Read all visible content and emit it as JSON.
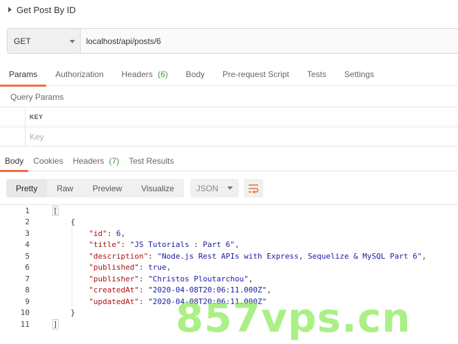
{
  "request": {
    "name": "Get Post By ID",
    "method": "GET",
    "url": "localhost/api/posts/6"
  },
  "request_tabs": [
    {
      "label": "Params",
      "count": ""
    },
    {
      "label": "Authorization",
      "count": ""
    },
    {
      "label": "Headers",
      "count": "(6)"
    },
    {
      "label": "Body",
      "count": ""
    },
    {
      "label": "Pre-request Script",
      "count": ""
    },
    {
      "label": "Tests",
      "count": ""
    },
    {
      "label": "Settings",
      "count": ""
    }
  ],
  "query_params": {
    "label": "Query Params",
    "column_header": "KEY",
    "key_placeholder": "Key"
  },
  "response_tabs": [
    {
      "label": "Body",
      "count": ""
    },
    {
      "label": "Cookies",
      "count": ""
    },
    {
      "label": "Headers",
      "count": "(7)"
    },
    {
      "label": "Test Results",
      "count": ""
    }
  ],
  "view_modes": [
    "Pretty",
    "Raw",
    "Preview",
    "Visualize"
  ],
  "format": "JSON",
  "icons": {
    "caret": "caret-right-icon",
    "dropdown": "chevron-down-icon",
    "wrap": "wrap-lines-icon"
  },
  "colors": {
    "accent": "#f26b3a",
    "count": "#3a9a3a",
    "json_key": "#a11111",
    "json_value": "#1a1aa6"
  },
  "response_lines": [
    {
      "n": "1",
      "text": "["
    },
    {
      "n": "2",
      "text": "    {"
    },
    {
      "n": "3",
      "key": "\"id\"",
      "value": "6",
      "type": "n"
    },
    {
      "n": "4",
      "key": "\"title\"",
      "value": "\"JS Tutorials : Part 6\"",
      "type": "s"
    },
    {
      "n": "5",
      "key": "\"description\"",
      "value": "\"Node.js Rest APIs with Express, Sequelize & MySQL Part 6\"",
      "type": "s"
    },
    {
      "n": "6",
      "key": "\"published\"",
      "value": "true",
      "type": "b"
    },
    {
      "n": "7",
      "key": "\"publisher\"",
      "value": "\"Christos Ploutarchou\"",
      "type": "s"
    },
    {
      "n": "8",
      "key": "\"createdAt\"",
      "value": "\"2020-04-08T20:06:11.000Z\"",
      "type": "s"
    },
    {
      "n": "9",
      "key": "\"updatedAt\"",
      "value": "\"2020-04-08T20:06:11.000Z\"",
      "type": "s",
      "last": true
    },
    {
      "n": "10",
      "text": "    }"
    },
    {
      "n": "11",
      "text": "]"
    }
  ],
  "watermark": "857vps.cn"
}
